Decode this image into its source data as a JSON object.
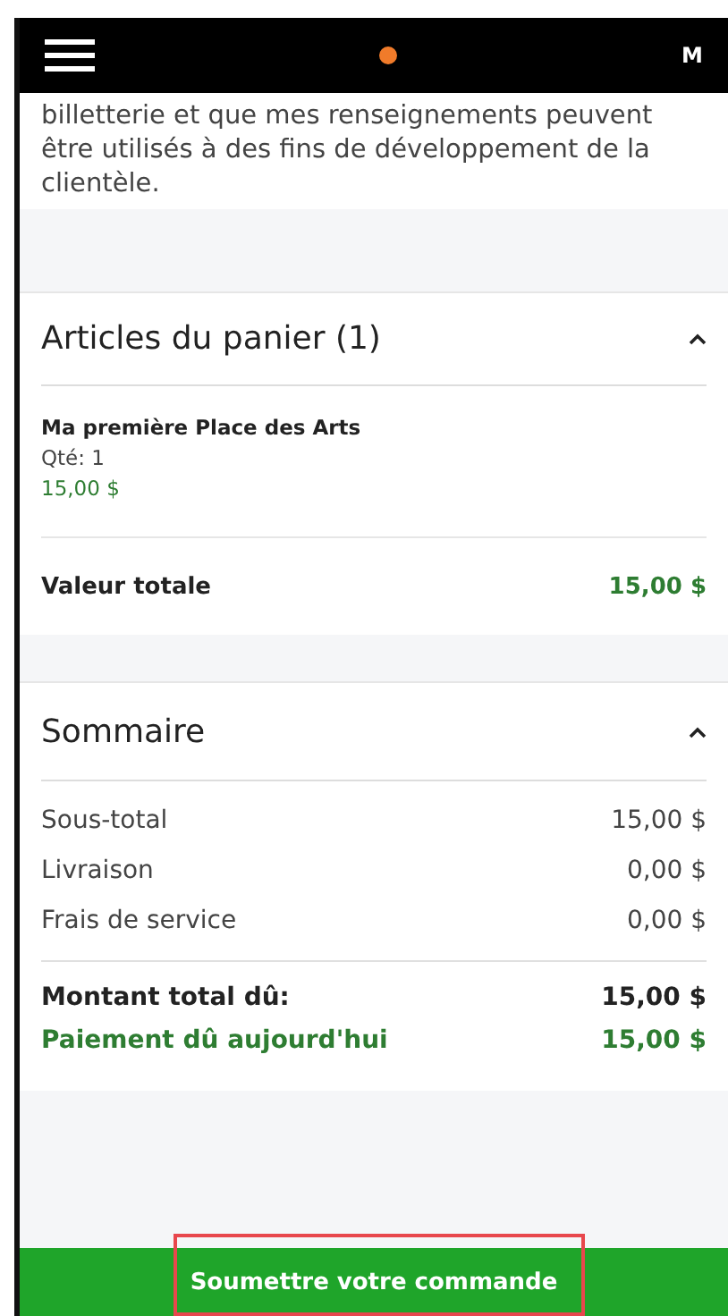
{
  "header": {
    "avatar_initial": "M"
  },
  "consent_text": "billetterie et que mes renseignements peuvent être utilisés à des fins de développement de la clientèle.",
  "cart": {
    "title": "Articles du panier (1)",
    "expanded": true,
    "items": [
      {
        "name": "Ma première Place des Arts",
        "quantity": "Qté: 1",
        "price": "15,00 $"
      }
    ],
    "total_label": "Valeur totale",
    "total_value": "15,00 $"
  },
  "summary": {
    "title": "Sommaire",
    "expanded": true,
    "rows": [
      {
        "label": "Sous-total",
        "value": "15,00 $",
        "kind": "plain"
      },
      {
        "label": "Livraison",
        "value": "0,00 $",
        "kind": "plain"
      },
      {
        "label": "Frais de service",
        "value": "0,00 $",
        "kind": "plain"
      },
      {
        "label": "Montant total dû:",
        "value": "15,00 $",
        "kind": "total"
      },
      {
        "label": "Paiement dû aujourd'hui",
        "value": "15,00 $",
        "kind": "due"
      }
    ]
  },
  "submit": {
    "label": "Soumettre votre commande",
    "highlighted": true
  }
}
